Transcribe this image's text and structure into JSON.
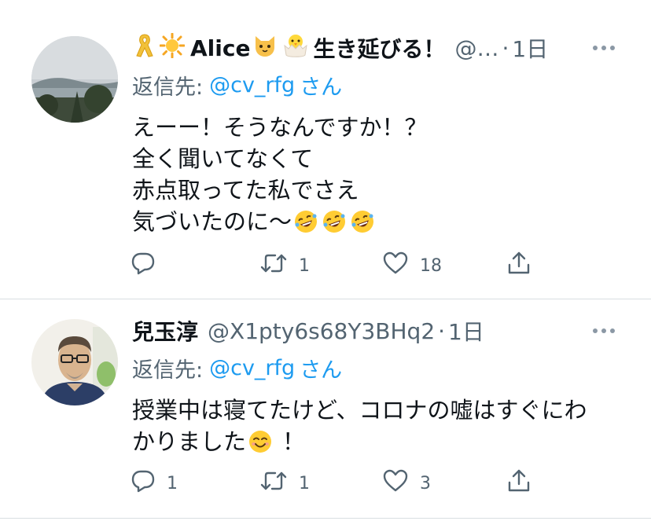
{
  "tweets": [
    {
      "display_name": "Alice",
      "name_suffix": "生き延びる！",
      "handle": "@…",
      "separator": "·",
      "time": "1日",
      "reply_prefix": "返信先:",
      "reply_to": "@cv_rfg",
      "reply_suffix": "さん",
      "body_lines": [
        "えーー！そうなんですか！？",
        "全く聞いてなくて",
        "赤点取ってた私でさえ",
        "気づいたのに〜"
      ],
      "reply_count": "",
      "retweet_count": "1",
      "like_count": "18",
      "icons": [
        "ribbon-icon",
        "sun-icon",
        "cat-face-icon",
        "hatching-chick-icon",
        "rofl-emoji"
      ]
    },
    {
      "display_name": "兒玉淳",
      "handle": "@X1pty6s68Y3BHq2",
      "separator": "·",
      "time": "1日",
      "reply_prefix": "返信先:",
      "reply_to": "@cv_rfg",
      "reply_suffix": "さん",
      "body_lines": [
        "授業中は寝てたけど、コロナの嘘はすぐにわ",
        "かりました",
        "！"
      ],
      "reply_count": "1",
      "retweet_count": "1",
      "like_count": "3",
      "icons": [
        "smiling-face-emoji"
      ]
    }
  ],
  "colors": {
    "link": "#1d9bf0",
    "secondary": "#536471",
    "text": "#0f1419",
    "divider": "#d9dee2"
  }
}
